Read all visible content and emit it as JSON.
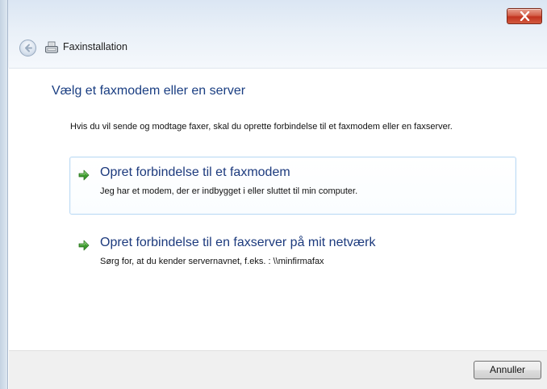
{
  "window": {
    "title": "Faxinstallation",
    "close_icon": "close-icon",
    "back_icon": "back-arrow-icon",
    "app_icon": "fax-icon"
  },
  "main": {
    "heading": "Vælg et faxmodem eller en server",
    "intro": "Hvis du vil sende og modtage faxer, skal du oprette forbindelse til et faxmodem eller en faxserver.",
    "options": [
      {
        "title": "Opret forbindelse til et faxmodem",
        "description": "Jeg har et modem, der er indbygget i eller sluttet til min computer.",
        "icon": "green-arrow-icon",
        "selected": true
      },
      {
        "title": "Opret forbindelse til en faxserver på mit netværk",
        "description": "Sørg for, at du kender servernavnet, f.eks. : \\\\minfirmafax",
        "icon": "green-arrow-icon",
        "selected": false
      }
    ]
  },
  "footer": {
    "cancel_label": "Annuller"
  },
  "colors": {
    "heading": "#1a3e82",
    "option_title": "#1c3a7d",
    "selection_border": "#bfdcf5",
    "close_button": "#c2331f",
    "arrow_green": "#3c9a2e"
  }
}
